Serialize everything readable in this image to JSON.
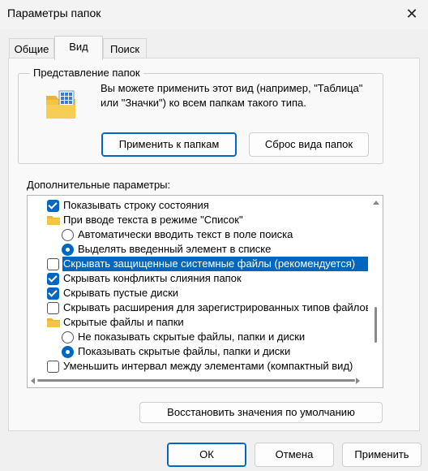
{
  "window": {
    "title": "Параметры папок",
    "close_glyph": "✕"
  },
  "tabs": [
    {
      "label": "Общие",
      "active": false
    },
    {
      "label": "Вид",
      "active": true
    },
    {
      "label": "Поиск",
      "active": false
    }
  ],
  "folder_views": {
    "group_title": "Представление папок",
    "description": "Вы можете применить этот вид (например, \"Таблица\" или \"Значки\") ко всем папкам такого типа.",
    "apply_button": "Применить к папкам",
    "reset_button": "Сброс вида папок"
  },
  "advanced": {
    "label": "Дополнительные параметры:",
    "items": [
      {
        "type": "checkbox",
        "checked": true,
        "level": 1,
        "label": "Показывать строку состояния",
        "selected": false
      },
      {
        "type": "folder",
        "level": 1,
        "label": "При вводе текста в режиме \"Список\"",
        "selected": false
      },
      {
        "type": "radio",
        "checked": false,
        "level": 2,
        "label": "Автоматически вводить текст в поле поиска",
        "selected": false
      },
      {
        "type": "radio",
        "checked": true,
        "level": 2,
        "label": "Выделять введенный элемент в списке",
        "selected": false
      },
      {
        "type": "checkbox",
        "checked": false,
        "level": 1,
        "label": "Скрывать защищенные системные файлы (рекомендуется)",
        "selected": true
      },
      {
        "type": "checkbox",
        "checked": true,
        "level": 1,
        "label": "Скрывать конфликты слияния папок",
        "selected": false
      },
      {
        "type": "checkbox",
        "checked": true,
        "level": 1,
        "label": "Скрывать пустые диски",
        "selected": false
      },
      {
        "type": "checkbox",
        "checked": false,
        "level": 1,
        "label": "Скрывать расширения для зарегистрированных типов файлов",
        "selected": false
      },
      {
        "type": "folder",
        "level": 1,
        "label": "Скрытые файлы и папки",
        "selected": false
      },
      {
        "type": "radio",
        "checked": false,
        "level": 2,
        "label": "Не показывать скрытые файлы, папки и диски",
        "selected": false
      },
      {
        "type": "radio",
        "checked": true,
        "level": 2,
        "label": "Показывать скрытые файлы, папки и диски",
        "selected": false
      },
      {
        "type": "checkbox",
        "checked": false,
        "level": 1,
        "label": "Уменьшить интервал между элементами (компактный вид)",
        "selected": false
      }
    ]
  },
  "buttons": {
    "restore": "Восстановить значения по умолчанию",
    "ok": "ОК",
    "cancel": "Отмена",
    "apply": "Применить"
  },
  "icons": {
    "folder_view": "folder-grid-icon",
    "list_folder": "folder-icon",
    "close": "close-icon"
  },
  "colors": {
    "accent": "#0067c0",
    "folder": "#f4c542",
    "window_bg": "#f0f0f0",
    "panel_bg": "#f9f9f9"
  }
}
